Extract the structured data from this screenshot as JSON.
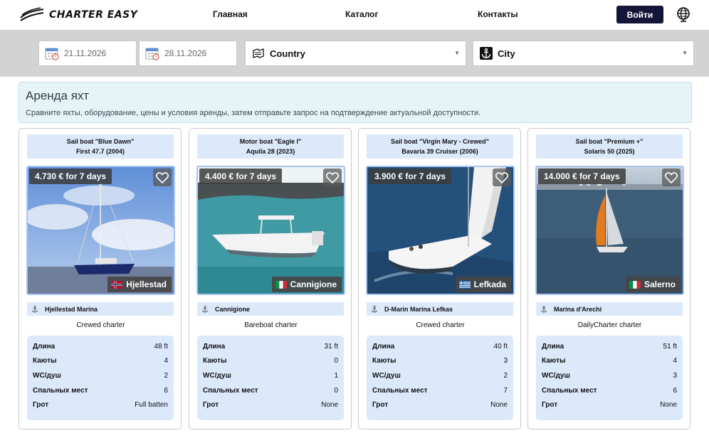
{
  "header": {
    "logo_text": "CHARTER EASY",
    "nav": [
      "Главная",
      "Каталог",
      "Контакты"
    ],
    "login_label": "Войти"
  },
  "search": {
    "date_from": "21.11.2026",
    "date_to": "28.11.2026",
    "country": "Country",
    "city": "City"
  },
  "intro": {
    "title": "Аренда яхт",
    "subtitle": "Сравните яхты, оборудование, цены и условия аренды, затем отправьте запрос на подтверждение актуальной доступности."
  },
  "spec_labels": [
    "Длина",
    "Каюты",
    "WC/душ",
    "Спальных мест",
    "Грот"
  ],
  "cards": [
    {
      "type_name": "Sail boat \"Blue Dawn\"",
      "model": "First 47.7 (2004)",
      "price": "4.730 € for 7 days",
      "location": "Hjellestad",
      "flag": "norway",
      "marina": "Hjellestad Marina",
      "charter": "Crewed charter",
      "specs": [
        "48 ft",
        "4",
        "2",
        "6",
        "Full batten"
      ]
    },
    {
      "type_name": "Motor boat \"Eagle I\"",
      "model": "Aquila 28 (2023)",
      "price": "4.400 € for 7 days",
      "location": "Cannigione",
      "flag": "italy",
      "marina": "Cannigione",
      "charter": "Bareboat charter",
      "specs": [
        "31 ft",
        "0",
        "1",
        "0",
        "None"
      ]
    },
    {
      "type_name": "Sail boat \"Virgin Mary - Crewed\"",
      "model": "Bavaria 39 Cruiser (2006)",
      "price": "3.900 € for 7 days",
      "location": "Lefkada",
      "flag": "greece",
      "marina": "D-Marin Marina Lefkas",
      "charter": "Crewed charter",
      "specs": [
        "40 ft",
        "3",
        "2",
        "7",
        "None"
      ]
    },
    {
      "type_name": "Sail boat \"Premium +\"",
      "model": "Solaris 50 (2025)",
      "price": "14.000 € for 7 days",
      "location": "Salerno",
      "flag": "italy",
      "marina": "Marina d'Arechi",
      "charter": "DailyCharter charter",
      "specs": [
        "51 ft",
        "4",
        "3",
        "6",
        "None"
      ]
    }
  ]
}
